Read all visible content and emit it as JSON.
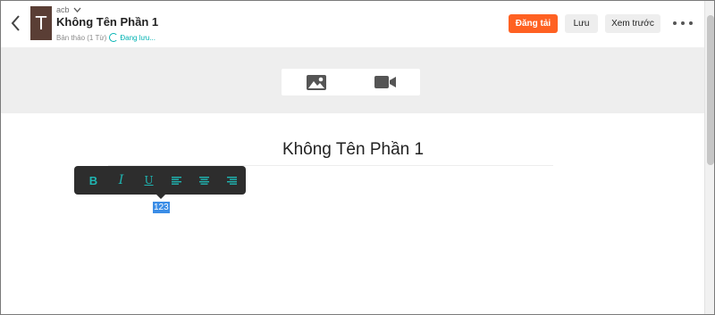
{
  "header": {
    "story_name": "acb",
    "cover_letter": "T",
    "part_title": "Không Tên Phần 1",
    "status": "Bản thảo (1 Từ)",
    "saving": "Đang lưu...",
    "publish_label": "Đăng tải",
    "save_label": "Lưu",
    "preview_label": "Xem trước"
  },
  "editor": {
    "title": "Không Tên Phần 1",
    "selected_text": "123"
  },
  "toolbar": {
    "bold": "B",
    "italic": "I",
    "underline": "U"
  },
  "colors": {
    "accent": "#ff6122",
    "toolbar_bg": "#2d2d2d",
    "toolbar_icon": "#1fb6b3",
    "selection": "#3b8de6",
    "saving": "#00b2b2"
  },
  "icons": {
    "back": "chevron-left-icon",
    "dropdown": "chevron-down-icon",
    "image": "image-icon",
    "video": "video-camera-icon",
    "more": "more-dots-icon"
  }
}
